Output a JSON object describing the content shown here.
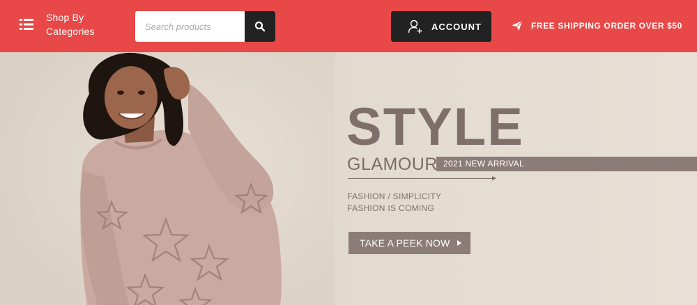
{
  "header": {
    "category_label": "Shop By\nCategories",
    "search": {
      "placeholder": "Search products",
      "value": ""
    },
    "account_label": "ACCOUNT",
    "shipping_text": "FREE SHIPPING ORDER OVER $50",
    "icons": {
      "categories": "list-icon",
      "search": "search-icon",
      "account": "user-add-icon",
      "shipping": "paper-plane-icon"
    },
    "colors": {
      "bar": "#e84848",
      "dark": "#222222"
    }
  },
  "hero": {
    "headline": "STYLE",
    "subheadline": "GLAMOUR",
    "arrival": "2021 NEW ARRIVAL",
    "tagline_1": "FASHION / SIMPLICITY",
    "tagline_2": "FASHION IS COMING",
    "cta_label": "TAKE A PEEK NOW",
    "colors": {
      "text": "#7f6f6b",
      "accent": "#8c7c78",
      "background": "#e3dbd2"
    }
  }
}
